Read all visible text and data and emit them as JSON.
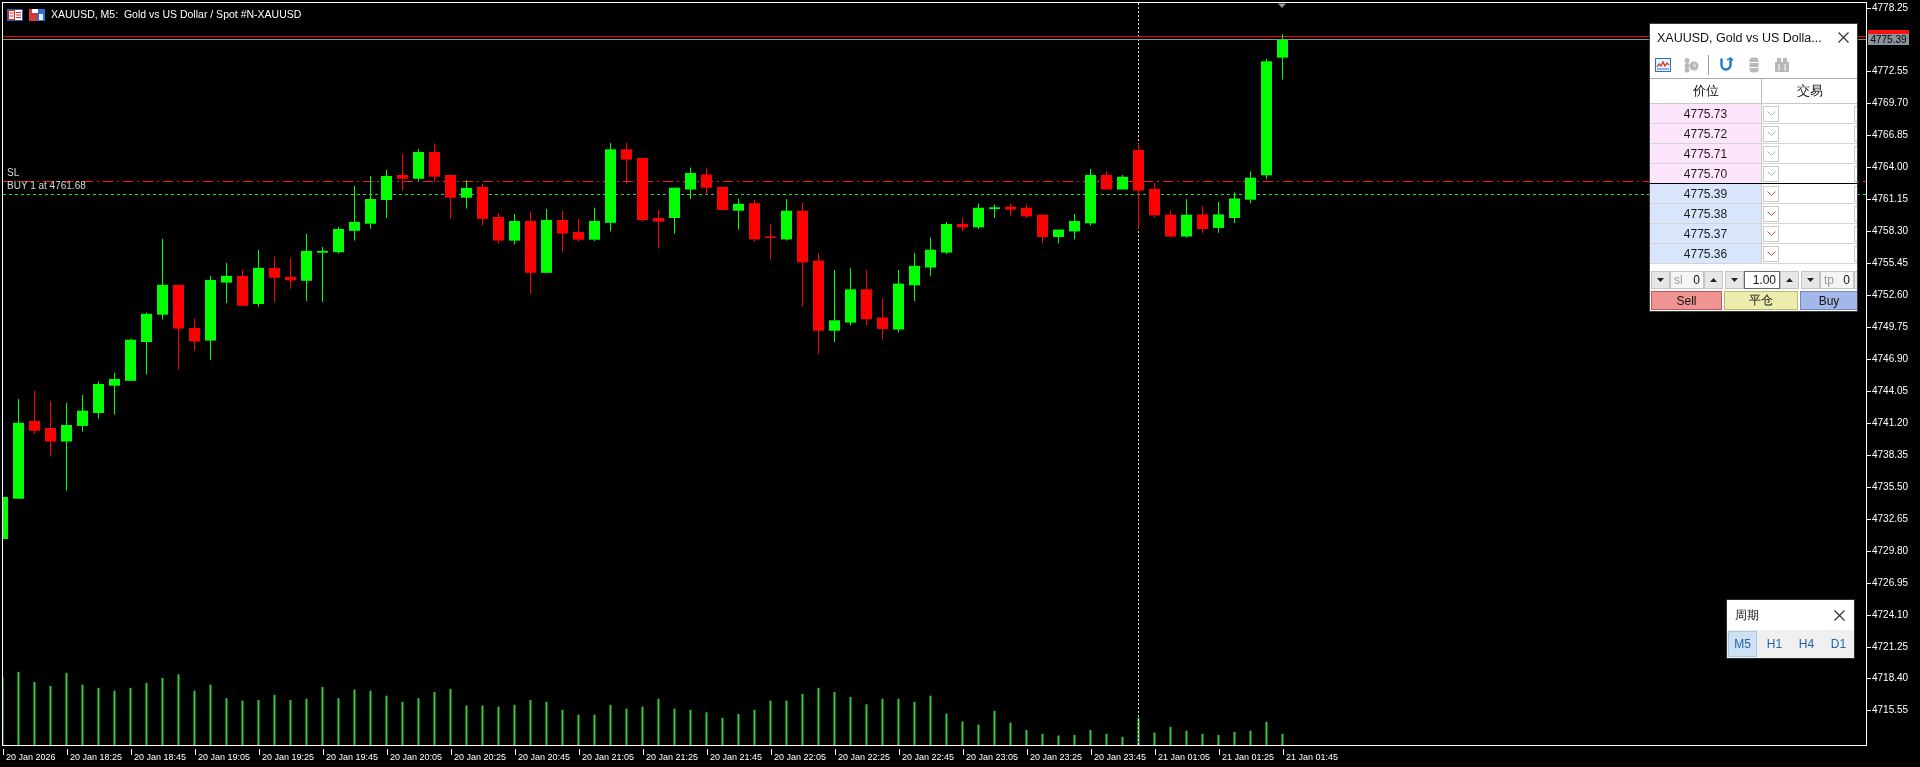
{
  "chart": {
    "title": "XAUUSD, M5:  Gold vs US Dollar / Spot #N-XAUUSD",
    "line_labels": [
      {
        "kind": "stop_loss",
        "text": "SL"
      },
      {
        "kind": "position",
        "text": "BUY 1 at 4761.68"
      }
    ],
    "price_axis": {
      "labels": [
        "4778.25",
        "4772.55",
        "4769.70",
        "4766.85",
        "4764.00",
        "4761.15",
        "4758.30",
        "4755.45",
        "4752.60",
        "4749.75",
        "4746.90",
        "4744.05",
        "4741.20",
        "4738.35",
        "4735.50",
        "4732.65",
        "4729.80",
        "4726.95",
        "4724.10",
        "4721.25",
        "4718.40",
        "4715.55"
      ],
      "bid_label": "4775.39"
    },
    "time_axis": {
      "labels": [
        "20 Jan 2026",
        "20 Jan 18:25",
        "20 Jan 18:45",
        "20 Jan 19:05",
        "20 Jan 19:25",
        "20 Jan 19:45",
        "20 Jan 20:05",
        "20 Jan 20:25",
        "20 Jan 20:45",
        "20 Jan 21:05",
        "20 Jan 21:25",
        "20 Jan 21:45",
        "20 Jan 22:05",
        "20 Jan 22:25",
        "20 Jan 22:45",
        "20 Jan 23:05",
        "20 Jan 23:25",
        "20 Jan 23:45",
        "21 Jan 01:05",
        "21 Jan 01:25",
        "21 Jan 01:45"
      ]
    }
  },
  "trade_panel": {
    "title": "XAUUSD, Gold vs US Dolla...",
    "toolbar": [
      {
        "kind": "chart",
        "disabled": false
      },
      {
        "kind": "coins",
        "disabled": true
      },
      {
        "kind": "magnet",
        "disabled": false
      },
      {
        "kind": "barrel",
        "disabled": true
      },
      {
        "kind": "box",
        "disabled": true
      }
    ],
    "columns": [
      "价位",
      "交易"
    ],
    "rows": [
      {
        "kind": "ask",
        "price": "4775.73"
      },
      {
        "kind": "ask",
        "price": "4775.72"
      },
      {
        "kind": "ask",
        "price": "4775.71"
      },
      {
        "kind": "ask",
        "price": "4775.70"
      },
      {
        "kind": "bid",
        "price": "4775.39"
      },
      {
        "kind": "bid",
        "price": "4775.38"
      },
      {
        "kind": "bid",
        "price": "4775.37"
      },
      {
        "kind": "bid",
        "price": "4775.36"
      }
    ],
    "order_fields": [
      {
        "kind": "sl",
        "label": "sl",
        "value": "0"
      },
      {
        "kind": "volume",
        "value": "1.00"
      },
      {
        "kind": "tp",
        "label": "tp",
        "value": "0"
      }
    ],
    "buttons": [
      {
        "kind": "sell",
        "label": "Sell"
      },
      {
        "kind": "close",
        "label": "平仓"
      },
      {
        "kind": "buy",
        "label": "Buy"
      }
    ]
  },
  "period_panel": {
    "title": "周期",
    "periods": [
      {
        "label": "M5",
        "selected": true
      },
      {
        "label": "H1",
        "selected": false
      },
      {
        "label": "H4",
        "selected": false
      },
      {
        "label": "D1",
        "selected": false
      }
    ]
  }
}
